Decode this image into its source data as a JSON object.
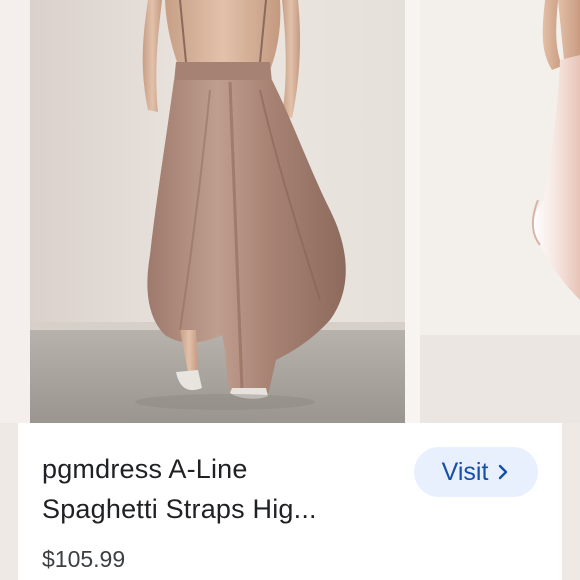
{
  "product": {
    "title_line1": "pgmdress A-Line",
    "title_line2": "Spaghetti Straps Hig...",
    "price": "$105.99"
  },
  "actions": {
    "visit_label": "Visit",
    "visit_icon": "chevron-right-icon"
  },
  "colors": {
    "button_bg": "#e8f0fe",
    "button_text": "#174ea6",
    "dress": "#b89585",
    "wall": "#e9e3dd",
    "floor": "#a7a29b"
  }
}
